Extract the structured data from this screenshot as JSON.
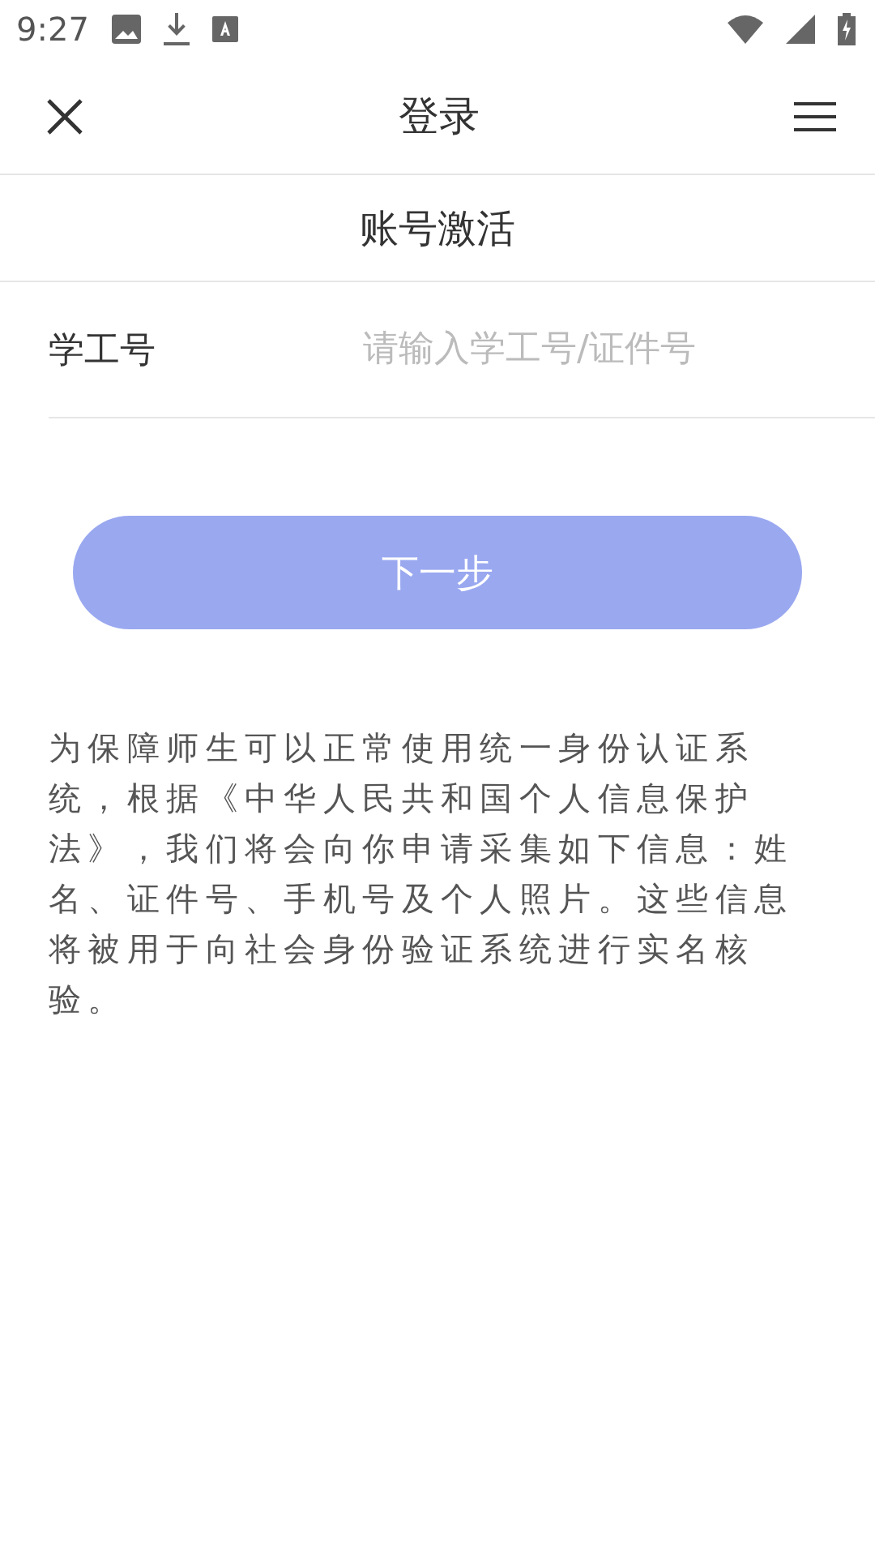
{
  "status_bar": {
    "time": "9:27"
  },
  "app_bar": {
    "title": "登录"
  },
  "section_title": "账号激活",
  "fields": [
    {
      "label": "学工号",
      "placeholder": "请输入学工号/证件号"
    }
  ],
  "next_button": {
    "label": "下一步",
    "disabled": true
  },
  "notice": "为保障师生可以正常使用统一身份认证系统，根据《中华人民共和国个人信息保护法》，我们将会向你申请采集如下信息：姓名、证件号、手机号及个人照片。这些信息将被用于向社会身份验证系统进行实名核验。"
}
